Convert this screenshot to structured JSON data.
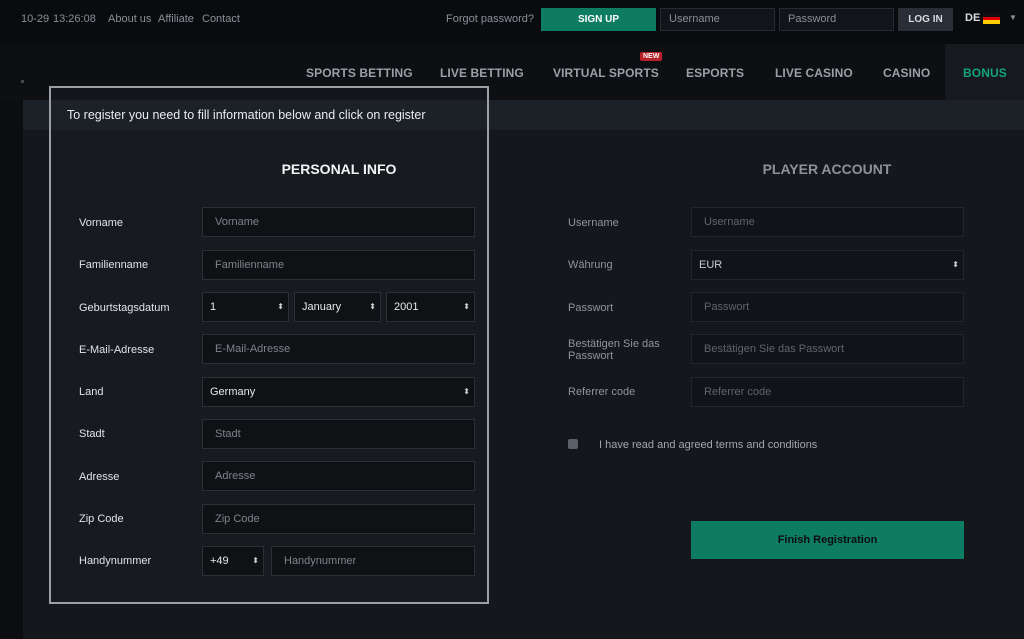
{
  "topbar": {
    "date": "10-29",
    "time": "13:26:08",
    "links": [
      "About us",
      "Affiliate",
      "Contact"
    ],
    "forgot": "Forgot password?",
    "signup": "SIGN UP",
    "username_placeholder": "Username",
    "password_placeholder": "Password",
    "login": "LOG IN",
    "lang": "DE"
  },
  "nav": {
    "items": [
      "SPORTS BETTING",
      "LIVE BETTING",
      "VIRTUAL SPORTS",
      "ESPORTS",
      "LIVE CASINO",
      "CASINO",
      "BONUS"
    ],
    "new_badge": "NEW",
    "active": "BONUS",
    "accent": "#12a57a"
  },
  "banner": "To register you need to fill information below and click on register",
  "personal": {
    "title": "PERSONAL INFO",
    "labels": {
      "first": "Vorname",
      "last": "Familienname",
      "dob": "Geburtstagsdatum",
      "email": "E-Mail-Adresse",
      "country": "Land",
      "city": "Stadt",
      "address": "Adresse",
      "zip": "Zip Code",
      "phone": "Handynummer"
    },
    "placeholders": {
      "first": "Vorname",
      "last": "Familienname",
      "email": "E-Mail-Adresse",
      "city": "Stadt",
      "address": "Adresse",
      "zip": "Zip Code",
      "phone": "Handynummer"
    },
    "dob_day": "1",
    "dob_month": "January",
    "dob_year": "2001",
    "country": "Germany",
    "phone_code": "+49"
  },
  "account": {
    "title": "PLAYER ACCOUNT",
    "labels": {
      "username": "Username",
      "currency": "Währung",
      "password": "Passwort",
      "confirm": "Bestätigen Sie das Passwort",
      "referrer": "Referrer code"
    },
    "placeholders": {
      "username": "Username",
      "password": "Passwort",
      "confirm": "Bestätigen Sie das Passwort",
      "referrer": "Referrer code"
    },
    "currency": "EUR",
    "terms": "I have read and agreed terms and conditions",
    "finish": "Finish Registration"
  },
  "colors": {
    "primary_button": "#0e7c62",
    "badge": "#b8202a"
  }
}
